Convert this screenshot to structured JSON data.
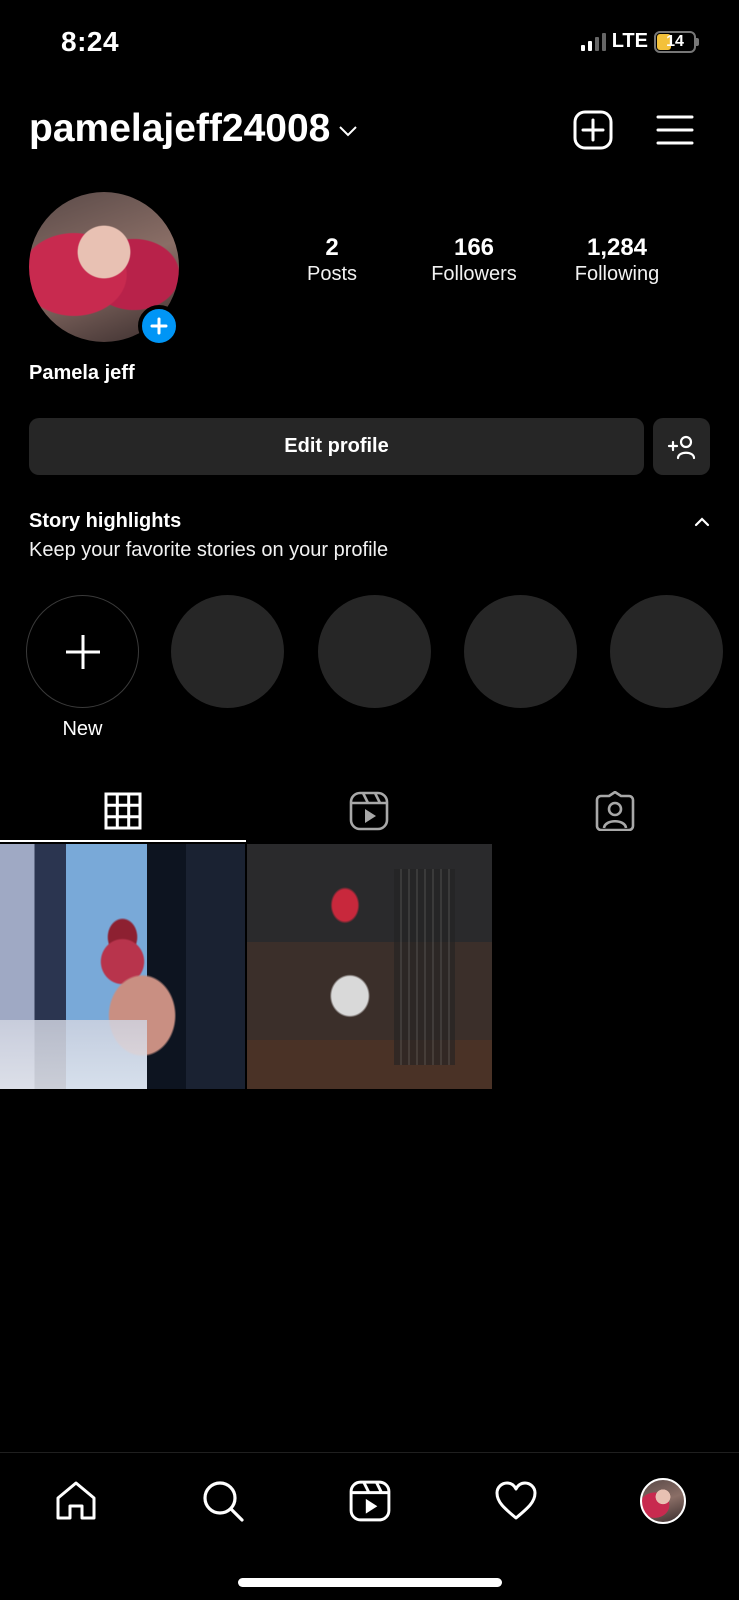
{
  "status_bar": {
    "time": "8:24",
    "network": "LTE",
    "battery": "14",
    "battery_color": "#f3c13a"
  },
  "header": {
    "username": "pamelajeff24008",
    "chevron_icon": "chevron-down-icon",
    "create_icon": "plus-square-icon",
    "menu_icon": "hamburger-menu-icon"
  },
  "profile": {
    "full_name": "Pamela jeff",
    "stats": [
      {
        "value": "2",
        "label": "Posts"
      },
      {
        "value": "166",
        "label": "Followers"
      },
      {
        "value": "1,284",
        "label": "Following"
      }
    ],
    "edit_label": "Edit profile",
    "accent_color": "#0095f6"
  },
  "highlights": {
    "title": "Story highlights",
    "subtitle": "Keep your favorite stories on your profile",
    "new_label": "New"
  },
  "tabs": [
    {
      "icon": "grid-icon",
      "active": true
    },
    {
      "icon": "reels-icon",
      "active": false
    },
    {
      "icon": "tagged-icon",
      "active": false
    }
  ],
  "bottom_nav": [
    {
      "icon": "home-icon"
    },
    {
      "icon": "search-icon"
    },
    {
      "icon": "reels-icon"
    },
    {
      "icon": "heart-icon"
    },
    {
      "icon": "profile-avatar"
    }
  ]
}
